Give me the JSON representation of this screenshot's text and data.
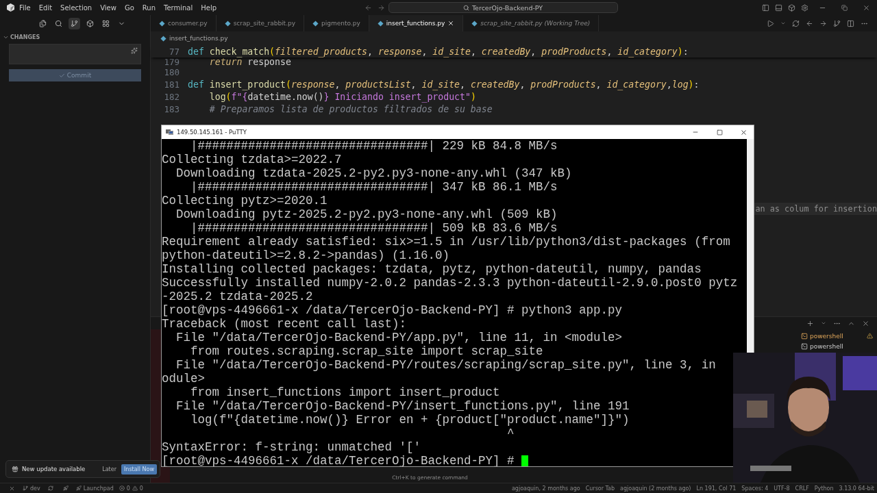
{
  "menu": [
    "File",
    "Edit",
    "Selection",
    "View",
    "Go",
    "Run",
    "Terminal",
    "Help"
  ],
  "command_center": "TercerOjo-Backend-PY",
  "sidebar": {
    "section": "CHANGES",
    "expanded": true,
    "commit_button": "Commit"
  },
  "tabs": [
    {
      "label": "consumer.py",
      "kind": "file",
      "selected": false
    },
    {
      "label": "scrap_site_rabbit.py",
      "kind": "file",
      "selected": false
    },
    {
      "label": "pigmento.py",
      "kind": "file",
      "selected": false
    },
    {
      "label": "insert_functions.py",
      "kind": "file",
      "selected": true
    },
    {
      "label": "scrap_site_rabbit.py (Working Tree)",
      "kind": "diff",
      "selected": false
    }
  ],
  "breadcrumb": "insert_functions.py",
  "code_lines": [
    {
      "number": "77",
      "sticky": true,
      "tokens": [
        {
          "text": "def ",
          "kind": "keyword"
        },
        {
          "text": "check_match",
          "kind": "function"
        },
        {
          "text": "(",
          "kind": "bracket"
        },
        {
          "text": "filtered_products",
          "kind": "param"
        },
        {
          "text": ", ",
          "kind": "plain"
        },
        {
          "text": "response",
          "kind": "param"
        },
        {
          "text": ", ",
          "kind": "plain"
        },
        {
          "text": "id_site",
          "kind": "param"
        },
        {
          "text": ", ",
          "kind": "plain"
        },
        {
          "text": "createdBy",
          "kind": "param"
        },
        {
          "text": ", ",
          "kind": "plain"
        },
        {
          "text": "prodProducts",
          "kind": "param"
        },
        {
          "text": ", ",
          "kind": "plain"
        },
        {
          "text": "id_category",
          "kind": "param"
        },
        {
          "text": ")",
          "kind": "bracket"
        },
        {
          "text": ":",
          "kind": "plain"
        }
      ]
    },
    {
      "number": "179",
      "sticky": false,
      "tokens": [
        {
          "text": "    return",
          "kind": "control"
        },
        {
          "text": " response",
          "kind": "plain"
        }
      ]
    },
    {
      "number": "180",
      "sticky": false
    },
    {
      "number": "181",
      "sticky": false,
      "tokens": [
        {
          "text": "def ",
          "kind": "keyword"
        },
        {
          "text": "insert_product",
          "kind": "function"
        },
        {
          "text": "(",
          "kind": "bracket"
        },
        {
          "text": "response",
          "kind": "param"
        },
        {
          "text": ", ",
          "kind": "plain"
        },
        {
          "text": "productsList",
          "kind": "param"
        },
        {
          "text": ", ",
          "kind": "plain"
        },
        {
          "text": "id_site",
          "kind": "param"
        },
        {
          "text": ", ",
          "kind": "plain"
        },
        {
          "text": "createdBy",
          "kind": "param"
        },
        {
          "text": ", ",
          "kind": "plain"
        },
        {
          "text": "prodProducts",
          "kind": "param"
        },
        {
          "text": ", ",
          "kind": "plain"
        },
        {
          "text": "id_category",
          "kind": "param"
        },
        {
          "text": ",",
          "kind": "plain"
        },
        {
          "text": "log",
          "kind": "param"
        },
        {
          "text": ")",
          "kind": "bracket"
        },
        {
          "text": ":",
          "kind": "plain"
        }
      ]
    },
    {
      "number": "182",
      "sticky": false,
      "tokens": [
        {
          "text": "    log",
          "kind": "function"
        },
        {
          "text": "(",
          "kind": "bracket"
        },
        {
          "text": "f\"",
          "kind": "string"
        },
        {
          "text": "{",
          "kind": "string"
        },
        {
          "text": "datetime.now()",
          "kind": "plain"
        },
        {
          "text": "} Iniciando insert_product\"",
          "kind": "string"
        },
        {
          "text": ")",
          "kind": "bracket"
        }
      ]
    },
    {
      "number": "183",
      "sticky": false,
      "tokens": [
        {
          "text": "    # Preparamos lista de productos filtrados de su base",
          "kind": "comment"
        }
      ]
    }
  ],
  "ghost_text": "an as colum for insertion",
  "putty": {
    "title": "149.50.145.161 - PuTTY",
    "cursor": true,
    "lines": [
      "    |################################| 229 kB 84.8 MB/s",
      "Collecting tzdata>=2022.7",
      "  Downloading tzdata-2025.2-py2.py3-none-any.whl (347 kB)",
      "    |################################| 347 kB 86.1 MB/s",
      "Collecting pytz>=2020.1",
      "  Downloading pytz-2025.2-py2.py3-none-any.whl (509 kB)",
      "    |################################| 509 kB 83.6 MB/s",
      "Requirement already satisfied: six>=1.5 in /usr/lib/python3/dist-packages (from",
      "python-dateutil>=2.8.2->pandas) (1.16.0)",
      "Installing collected packages: tzdata, pytz, python-dateutil, numpy, pandas",
      "Successfully installed numpy-2.0.2 pandas-2.3.3 python-dateutil-2.9.0.post0 pytz",
      "-2025.2 tzdata-2025.2",
      "[root@vps-4496661-x /data/TercerOjo-Backend-PY] # python3 app.py",
      "Traceback (most recent call last):",
      "  File \"/data/TercerOjo-Backend-PY/app.py\", line 11, in <module>",
      "    from routes.scraping.scrap_site import scrap_site",
      "  File \"/data/TercerOjo-Backend-PY/routes/scraping/scrap_site.py\", line 3, in",
      "odule>",
      "    from insert_functions import insert_product",
      "  File \"/data/TercerOjo-Backend-PY/insert_functions.py\", line 191",
      "    log(f\"{datetime.now()} Error en + {product[\"product.name\"]}\")",
      "                                                ^",
      "SyntaxError: f-string: unmatched '['",
      "[root@vps-4496661-x /data/TercerOjo-Backend-PY] # "
    ]
  },
  "panel": {
    "hint": "Ctrl+K to generate command",
    "terminals": [
      {
        "label": "powershell",
        "warning": true
      },
      {
        "label": "powershell",
        "warning": false
      }
    ]
  },
  "notification": {
    "message": "New update available",
    "dismiss": "Later",
    "action": "Install Now"
  },
  "status_bar": {
    "branch": "dev",
    "launchpad": "Launchpad",
    "errors": "0",
    "warnings": "0",
    "right": [
      "agjoaquin, 2 months ago",
      "Cursor Tab",
      "agjoaquin (2 months ago)",
      "Ln 191, Col 71",
      "Spaces: 4",
      "UTF-8",
      "CRLF",
      "Python",
      "3.13.0 64-bit"
    ]
  }
}
